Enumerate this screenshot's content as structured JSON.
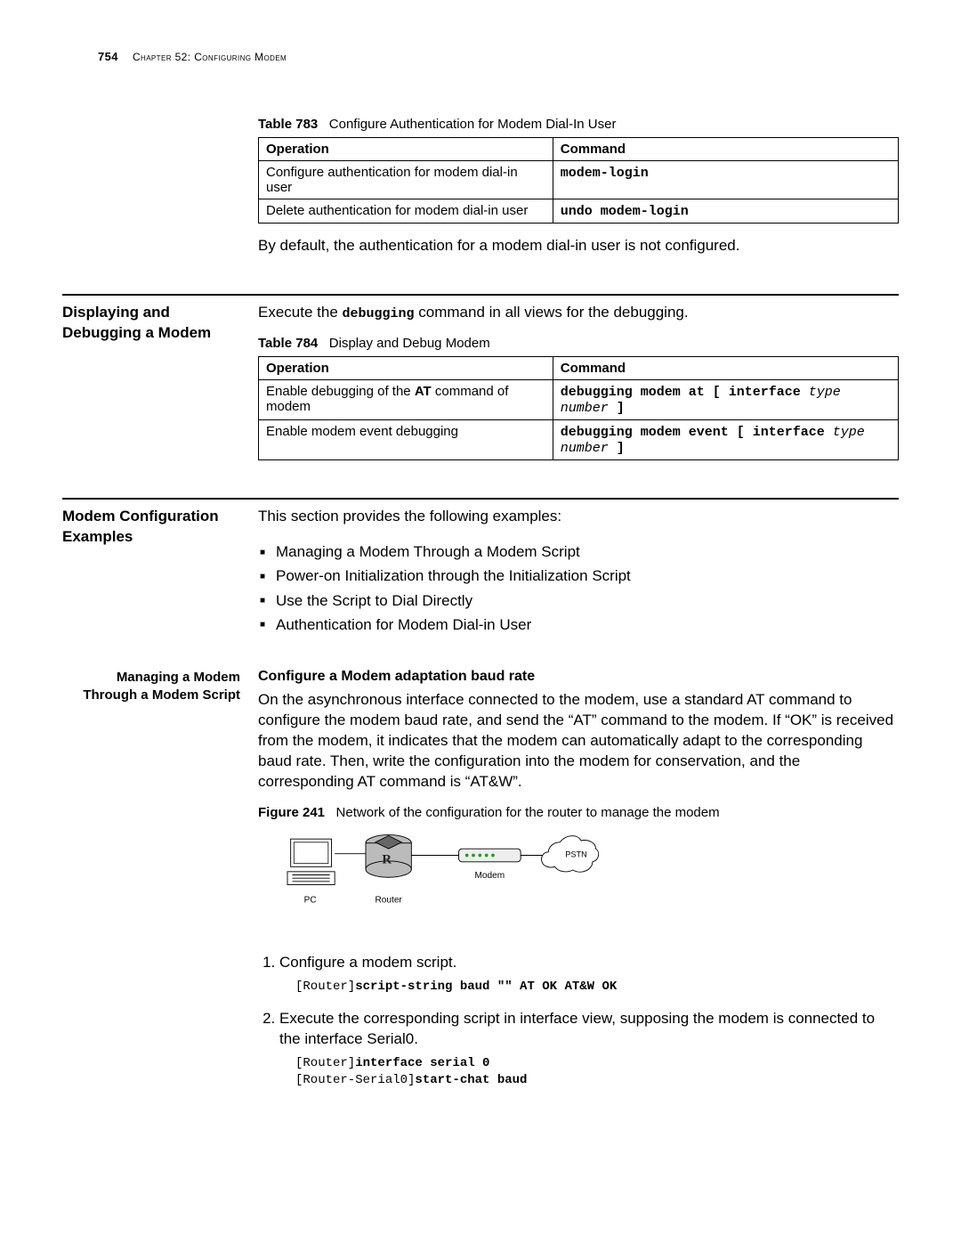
{
  "header": {
    "page_number": "754",
    "chapter_label": "Chapter 52: Configuring Modem"
  },
  "table783": {
    "caption_bold": "Table 783",
    "caption_rest": "Configure Authentication for Modem Dial-In User",
    "head_op": "Operation",
    "head_cmd": "Command",
    "rows": [
      {
        "op": "Configure authentication for modem dial-in user",
        "cmd_pre": "modem-login"
      },
      {
        "op": "Delete authentication for modem dial-in user",
        "cmd_pre": "undo modem-login"
      }
    ]
  },
  "default_note": "By default, the authentication for a modem dial-in user is not configured.",
  "section_debug": {
    "left_title_l1": "Displaying and",
    "left_title_l2": "Debugging a Modem",
    "intro_before": "Execute the ",
    "intro_code": "debugging",
    "intro_after": " command in all views for the debugging."
  },
  "table784": {
    "caption_bold": "Table 784",
    "caption_rest": "Display and Debug Modem",
    "head_op": "Operation",
    "head_cmd": "Command",
    "rows": [
      {
        "op_before": "Enable debugging of the ",
        "op_bold": "AT",
        "op_after": " command of modem",
        "cmd_bold": "debugging modem at [ interface ",
        "cmd_ital": "type number",
        "cmd_bold2": " ]"
      },
      {
        "op_before": "Enable modem event debugging",
        "op_bold": "",
        "op_after": "",
        "cmd_bold": "debugging modem event [ interface ",
        "cmd_ital": "type number",
        "cmd_bold2": " ]"
      }
    ]
  },
  "section_examples": {
    "left_title_l1": "Modem Configuration",
    "left_title_l2": "Examples",
    "intro": "This section provides the following examples:",
    "bullets": [
      "Managing a Modem Through a Modem Script",
      "Power-on Initialization through the Initialization Script",
      "Use the Script to Dial Directly",
      "Authentication for Modem Dial-in User"
    ]
  },
  "sub_manage": {
    "left_title_l1": "Managing a Modem",
    "left_title_l2": "Through a Modem Script",
    "right_title": "Configure a Modem adaptation baud rate",
    "para": "On the asynchronous interface connected to the modem, use a standard AT command to configure the modem baud rate, and send the “AT” command to the modem. If “OK” is received from the modem, it indicates that the modem can automatically adapt to the corresponding baud rate. Then, write the configuration into the modem for conservation, and the corresponding AT command is “AT&W”."
  },
  "figure": {
    "caption_bold": "Figure 241",
    "caption_rest": "Network of the configuration for the router to manage the modem",
    "labels": {
      "pc": "PC",
      "router": "Router",
      "modem": "Modem",
      "pstn": "PSTN"
    }
  },
  "steps": {
    "s1": "Configure a modem script.",
    "code1_prefix": "[Router]",
    "code1_bold": "script-string baud \"\" AT OK AT&W OK",
    "s2": "Execute the corresponding script in interface view, supposing the modem is connected to the interface Serial0.",
    "code2a_prefix": "[Router]",
    "code2a_bold": "interface serial 0",
    "code2b_prefix": "[Router-Serial0]",
    "code2b_bold": "start-chat baud"
  }
}
